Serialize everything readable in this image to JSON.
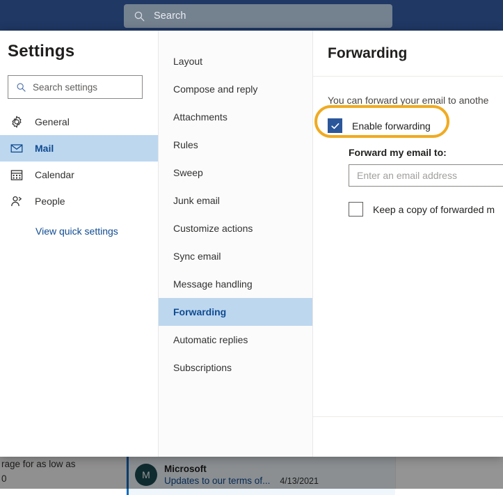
{
  "top_bar": {
    "search_placeholder": "Search",
    "search_icon": "search-icon",
    "background": "#1f3864",
    "pill_color": "#74818f"
  },
  "background_app": {
    "ad_line_1": "rage for as low as",
    "ad_line_2": "0",
    "mail_row": {
      "avatar_initial": "M",
      "sender": "Microsoft",
      "subject": "Updates to our terms of...",
      "date": "4/13/2021"
    }
  },
  "dialog": {
    "title": "Settings",
    "search": {
      "placeholder": "Search settings",
      "icon": "search-icon"
    },
    "categories": [
      {
        "label": "General",
        "icon": "gear-icon",
        "active": false
      },
      {
        "label": "Mail",
        "icon": "envelope-icon",
        "active": true
      },
      {
        "label": "Calendar",
        "icon": "calendar-icon",
        "active": false
      },
      {
        "label": "People",
        "icon": "person-icon",
        "active": false
      }
    ],
    "quick_settings_link": "View quick settings",
    "sub_nav": [
      {
        "label": "Layout",
        "active": false
      },
      {
        "label": "Compose and reply",
        "active": false
      },
      {
        "label": "Attachments",
        "active": false
      },
      {
        "label": "Rules",
        "active": false
      },
      {
        "label": "Sweep",
        "active": false
      },
      {
        "label": "Junk email",
        "active": false
      },
      {
        "label": "Customize actions",
        "active": false
      },
      {
        "label": "Sync email",
        "active": false
      },
      {
        "label": "Message handling",
        "active": false
      },
      {
        "label": "Forwarding",
        "active": true
      },
      {
        "label": "Automatic replies",
        "active": false
      },
      {
        "label": "Subscriptions",
        "active": false
      }
    ],
    "detail": {
      "title": "Forwarding",
      "description": "You can forward your email to anothe",
      "enable_forwarding_label": "Enable forwarding",
      "enable_forwarding_checked": true,
      "forward_to_label": "Forward my email to:",
      "forward_to_value": "",
      "forward_to_placeholder": "Enter an email address",
      "keep_copy_label": "Keep a copy of forwarded m",
      "keep_copy_checked": false
    }
  },
  "annotation": {
    "target": "enable-forwarding-checkbox",
    "color": "#f0ab22",
    "shape": "ellipse"
  },
  "colors": {
    "accent_blue": "#0f4b91",
    "selection_blue": "#bdd7ef",
    "checkbox_blue": "#2b579a",
    "highlight_orange": "#f0ab22",
    "header_navy": "#1f3864"
  }
}
